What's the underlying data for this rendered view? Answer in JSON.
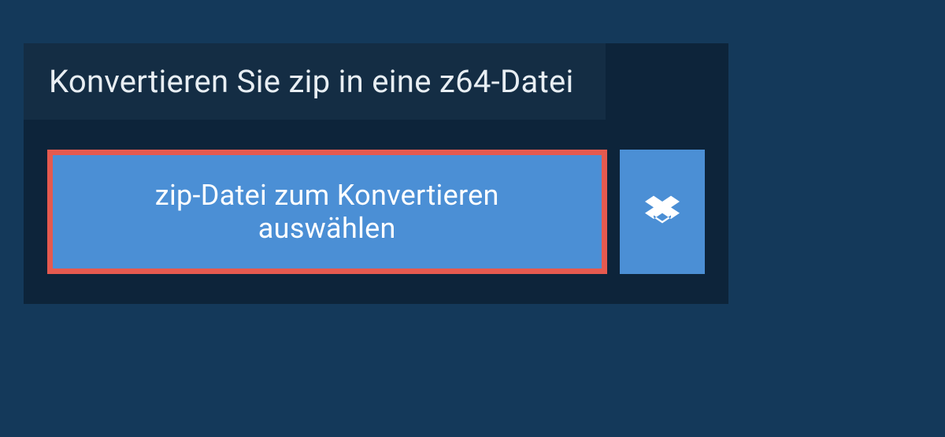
{
  "heading": "Konvertieren Sie zip in eine z64-Datei",
  "buttons": {
    "choose_file": "zip-Datei zum Konvertieren auswählen"
  },
  "colors": {
    "page_bg": "#14395a",
    "panel_bg": "#0d243a",
    "heading_bg": "#142d44",
    "button_bg": "#4b8fd5",
    "highlight_border": "#e55a4f",
    "text_light": "#e8eef3",
    "text_white": "#ffffff"
  }
}
